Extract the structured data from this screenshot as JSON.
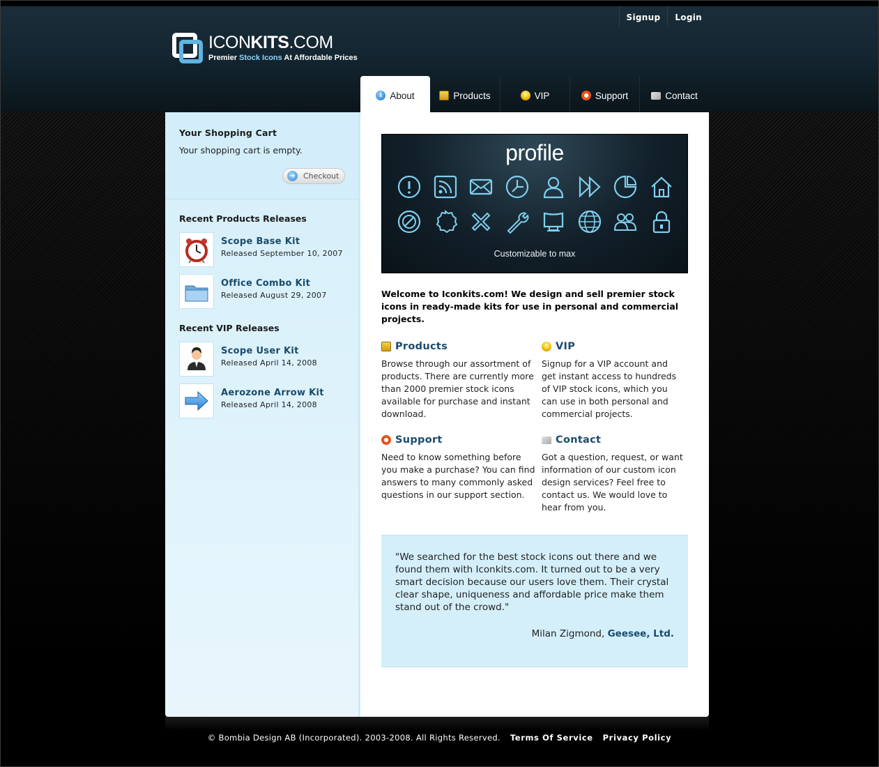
{
  "top_links": [
    "Signup",
    "Login"
  ],
  "logo": {
    "title_light": "ICON",
    "title_bold": "KITS",
    "title_tail": ".COM",
    "sub_a": "Premier ",
    "sub_b": "Stock Icons",
    "sub_c": " At Affordable Prices"
  },
  "nav": [
    {
      "label": "About",
      "icon": "info-icon",
      "active": true
    },
    {
      "label": "Products",
      "icon": "box-icon"
    },
    {
      "label": "VIP",
      "icon": "bulb-icon"
    },
    {
      "label": "Support",
      "icon": "lifebuoy-icon"
    },
    {
      "label": "Contact",
      "icon": "mail-icon"
    }
  ],
  "cart": {
    "title": "Your Shopping Cart",
    "empty_text": "Your shopping cart is empty.",
    "checkout_label": "Checkout"
  },
  "recent_products": {
    "title": "Recent Products Releases",
    "items": [
      {
        "name": "Scope Base Kit",
        "date": "Released September 10, 2007",
        "icon": "alarm-clock-icon"
      },
      {
        "name": "Office Combo Kit",
        "date": "Released August 29, 2007",
        "icon": "folder-icon"
      }
    ]
  },
  "recent_vip": {
    "title": "Recent VIP Releases",
    "items": [
      {
        "name": "Scope User Kit",
        "date": "Released April 14, 2008",
        "icon": "user-icon"
      },
      {
        "name": "Aerozone Arrow Kit",
        "date": "Released April 14, 2008",
        "icon": "arrow-right-icon"
      }
    ]
  },
  "banner": {
    "title": "profile",
    "subtitle": "Customizable to max"
  },
  "welcome": "Welcome to Iconkits.com! We design and sell premier stock icons in ready-made kits for use in personal and commercial projects.",
  "features": [
    {
      "title": "Products",
      "icon": "box-icon",
      "text": "Browse through our assortment of products. There are currently more than 2000 premier stock icons available for purchase and instant download."
    },
    {
      "title": "VIP",
      "icon": "bulb-icon",
      "text": "Signup for a VIP account and get instant access to hundreds of VIP stock icons, which you can use in both personal and commercial projects."
    },
    {
      "title": "Support",
      "icon": "lifebuoy-icon",
      "text": "Need to know something before you make a purchase? You can find answers to many commonly asked questions in our support section."
    },
    {
      "title": "Contact",
      "icon": "mail-icon",
      "text": "Got a question, request, or want information of our custom icon design services? Feel free to contact us. We would love to hear from you."
    }
  ],
  "testimonial": {
    "quote": "\"We searched for the best stock icons out there and we found them with Iconkits.com. It turned out to be a very smart decision because our users love them. Their crystal clear shape, uniqueness and affordable price make them stand out of the crowd.\"",
    "author": "Milan Zigmond, ",
    "company": "Geesee, Ltd."
  },
  "footer": {
    "copyright": "© Bombia Design AB (Incorporated). 2003-2008. All Rights Reserved.",
    "terms": "Terms Of Service",
    "privacy": "Privacy Policy"
  },
  "colors": {
    "accent_blue": "#5fb4e4",
    "link_dark_blue": "#1a4b6b",
    "sidebar_bg": "#d5effa"
  }
}
